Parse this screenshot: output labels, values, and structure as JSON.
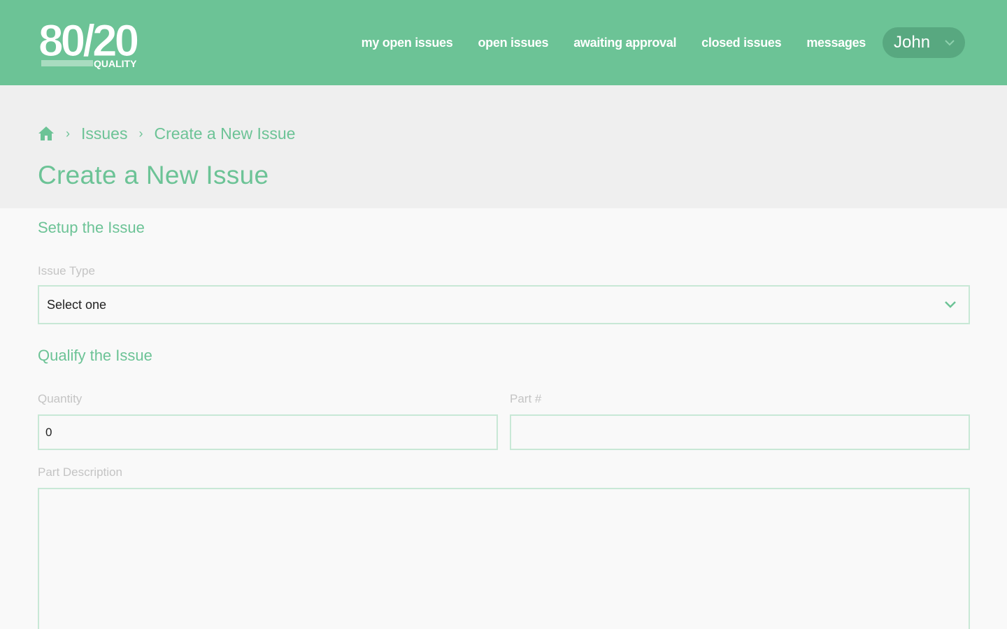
{
  "colors": {
    "brand": "#6cc396",
    "brand_dark": "#58a880",
    "title_band": "#efefef",
    "field_border": "#c8e8d6",
    "label_gray": "#c4c4c4"
  },
  "header": {
    "logo": {
      "main": "80/20",
      "sub": "QUALITY"
    },
    "nav": [
      {
        "label": "my open issues"
      },
      {
        "label": "open issues"
      },
      {
        "label": "awaiting approval"
      },
      {
        "label": "closed issues"
      },
      {
        "label": "messages"
      }
    ],
    "user": {
      "name": "John",
      "icon": "chevron-down-icon"
    }
  },
  "breadcrumb": {
    "home_icon": "home-icon",
    "separator": "›",
    "items": [
      {
        "label": "Issues"
      },
      {
        "label": "Create a New Issue"
      }
    ]
  },
  "page": {
    "title": "Create a New Issue"
  },
  "form": {
    "setup": {
      "title": "Setup the Issue",
      "issue_type": {
        "label": "Issue Type",
        "value": "Select one",
        "icon": "chevron-down-icon"
      }
    },
    "qualify": {
      "title": "Qualify the Issue",
      "quantity": {
        "label": "Quantity",
        "value": "0"
      },
      "part_number": {
        "label": "Part #",
        "value": ""
      },
      "part_description": {
        "label": "Part Description",
        "value": ""
      }
    }
  }
}
